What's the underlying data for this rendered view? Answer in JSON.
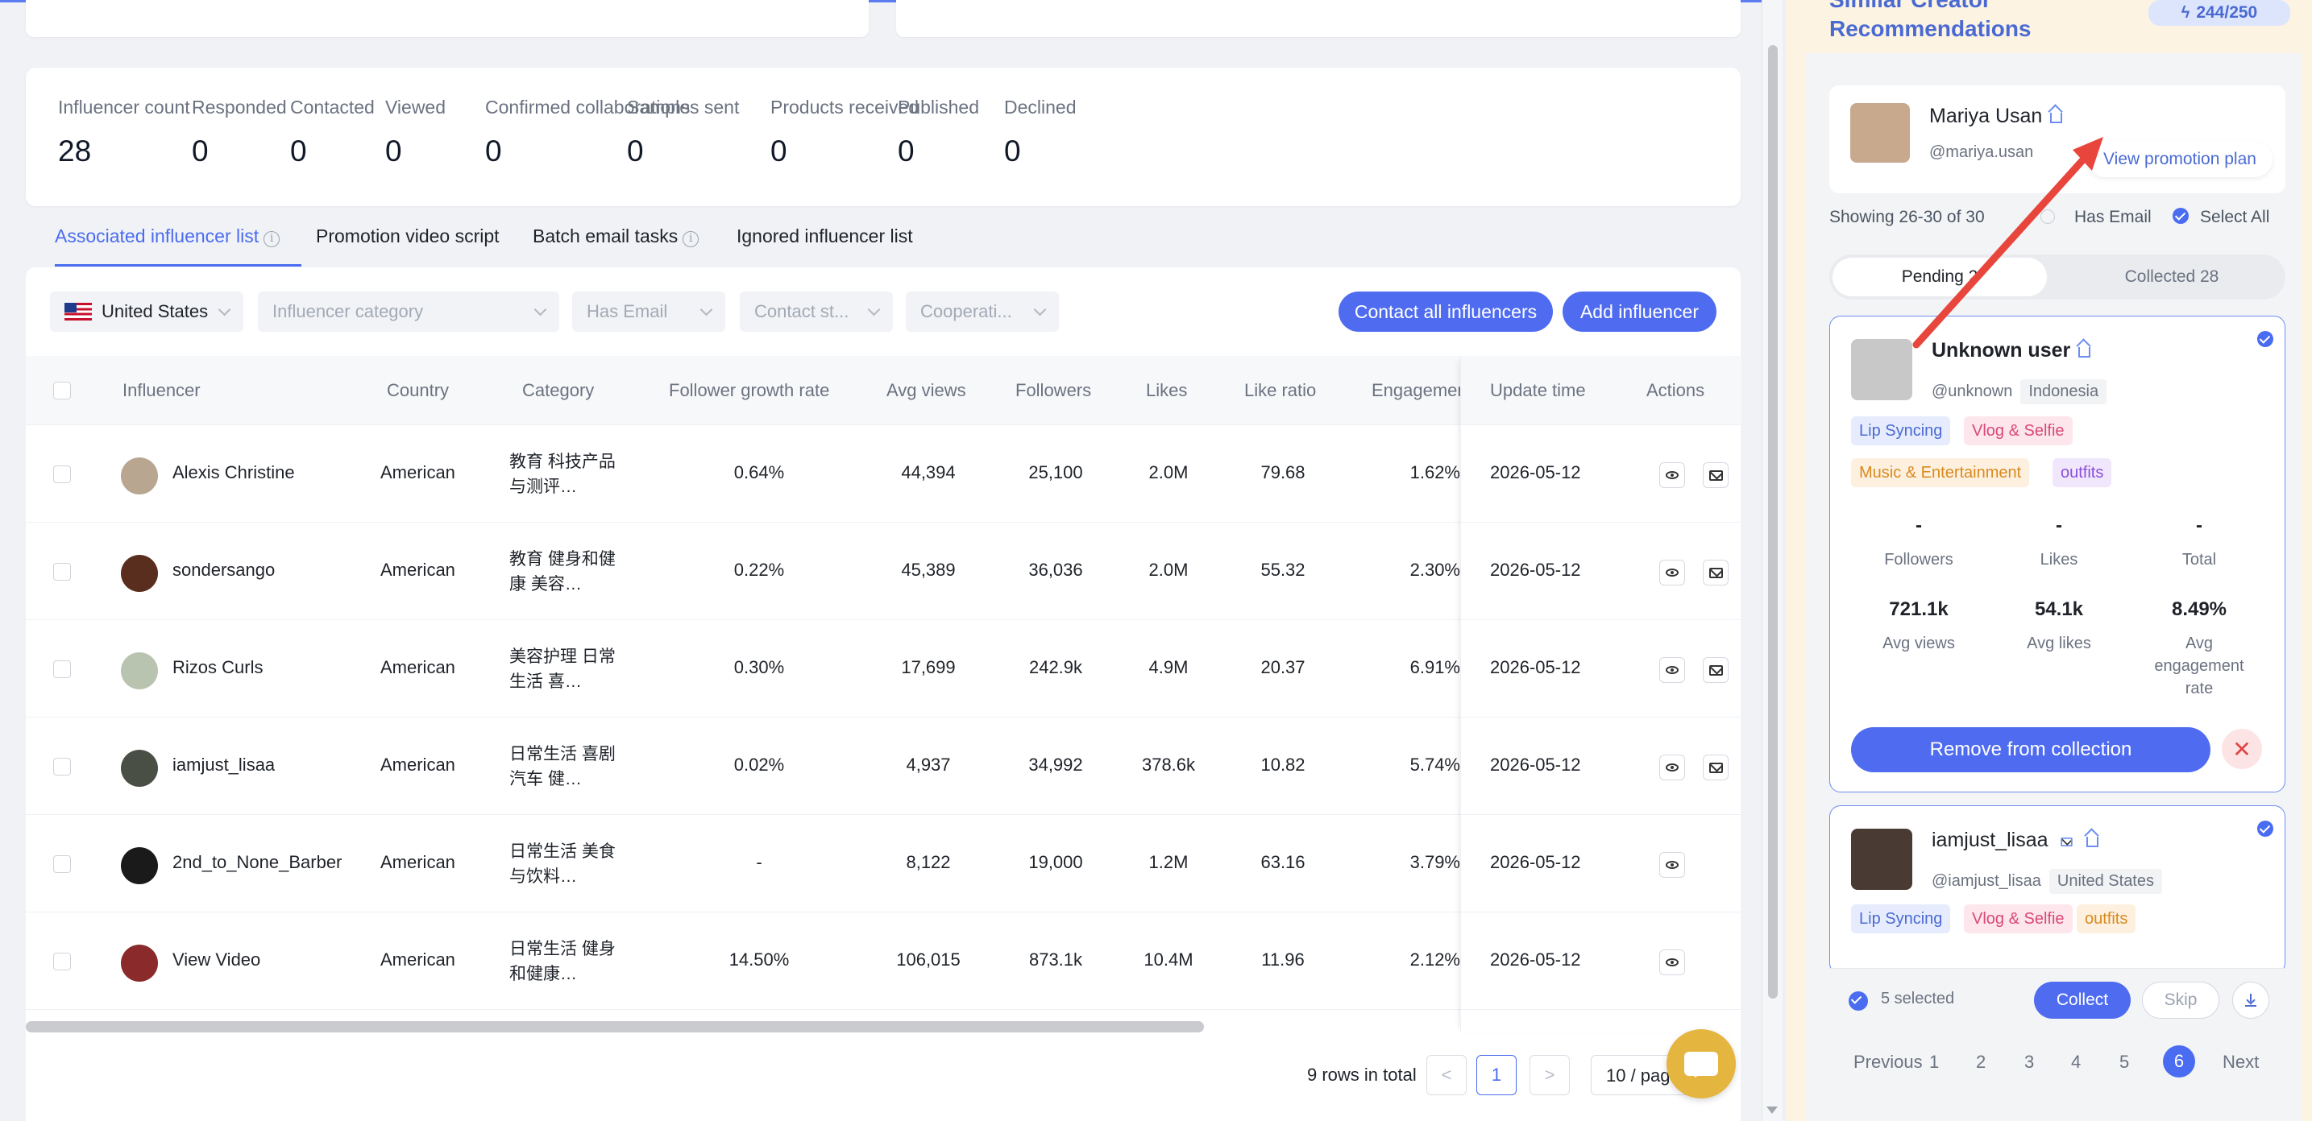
{
  "stats": [
    {
      "label": "Influencer count",
      "value": "28"
    },
    {
      "label": "Responded",
      "value": "0"
    },
    {
      "label": "Contacted",
      "value": "0"
    },
    {
      "label": "Viewed",
      "value": "0"
    },
    {
      "label": "Confirmed collaborations",
      "value": "0"
    },
    {
      "label": "Samples sent",
      "value": "0"
    },
    {
      "label": "Products received",
      "value": "0"
    },
    {
      "label": "Published",
      "value": "0"
    },
    {
      "label": "Declined",
      "value": "0"
    }
  ],
  "tabs": [
    "Associated influencer list",
    "Promotion video script",
    "Batch email tasks",
    "Ignored influencer list"
  ],
  "filters": {
    "country": "United States",
    "category": "Influencer category",
    "email": "Has Email",
    "contact": "Contact st...",
    "coop": "Cooperati..."
  },
  "buttons": {
    "contact_all": "Contact all influencers",
    "add": "Add influencer"
  },
  "columns": [
    "Influencer",
    "Country",
    "Category",
    "Follower growth rate",
    "Avg views",
    "Followers",
    "Likes",
    "Like ratio",
    "Engagemer",
    "Update time",
    "Actions"
  ],
  "rows": [
    {
      "name": "Alexis Christine",
      "country": "American",
      "category": "教育 科技产品与测评…",
      "growth": "0.64%",
      "avg_views": "44,394",
      "followers": "25,100",
      "likes": "2.0M",
      "like_ratio": "79.68",
      "engagement": "1.62%",
      "updated": "2026-05-12",
      "mail": true,
      "avatar_color": "#b8a690"
    },
    {
      "name": "sondersango",
      "country": "American",
      "category": "教育 健身和健康 美容…",
      "growth": "0.22%",
      "avg_views": "45,389",
      "followers": "36,036",
      "likes": "2.0M",
      "like_ratio": "55.32",
      "engagement": "2.30%",
      "updated": "2026-05-12",
      "mail": true,
      "avatar_color": "#5a2e1e"
    },
    {
      "name": "Rizos Curls",
      "country": "American",
      "category": "美容护理 日常生活 喜…",
      "growth": "0.30%",
      "avg_views": "17,699",
      "followers": "242.9k",
      "likes": "4.9M",
      "like_ratio": "20.37",
      "engagement": "6.91%",
      "updated": "2026-05-12",
      "mail": true,
      "avatar_color": "#b9c4b0"
    },
    {
      "name": "iamjust_lisaa",
      "country": "American",
      "category": "日常生活 喜剧 汽车 健…",
      "growth": "0.02%",
      "avg_views": "4,937",
      "followers": "34,992",
      "likes": "378.6k",
      "like_ratio": "10.82",
      "engagement": "5.74%",
      "updated": "2026-05-12",
      "mail": true,
      "avatar_color": "#4a4f45"
    },
    {
      "name": "2nd_to_None_Barber",
      "country": "American",
      "category": "日常生活 美食与饮料…",
      "growth": "-",
      "avg_views": "8,122",
      "followers": "19,000",
      "likes": "1.2M",
      "like_ratio": "63.16",
      "engagement": "3.79%",
      "updated": "2026-05-12",
      "mail": false,
      "avatar_color": "#1a1a1a"
    },
    {
      "name": "View Video",
      "country": "American",
      "category": "日常生活 健身和健康…",
      "growth": "14.50%",
      "avg_views": "106,015",
      "followers": "873.1k",
      "likes": "10.4M",
      "like_ratio": "11.96",
      "engagement": "2.12%",
      "updated": "2026-05-12",
      "mail": false,
      "avatar_color": "#8a2a2a"
    }
  ],
  "pagination": {
    "total": "9 rows in total",
    "current": "1",
    "prev": "<",
    "next": ">",
    "page_size": "10 / page"
  },
  "panel": {
    "title": "Similar Creator Recommendations",
    "quota": "244/250",
    "current_user": {
      "name": "Mariya Usan",
      "handle": "@mariya.usan",
      "view_plan": "View promotion plan"
    },
    "showing": "Showing 26-30 of 30",
    "has_email": "Has Email",
    "select_all": "Select All",
    "seg_pending": "Pending 2",
    "seg_collected": "Collected 28",
    "card1": {
      "name": "Unknown user",
      "handle": "@unknown",
      "location": "Indonesia",
      "tags": [
        "Lip Syncing",
        "Vlog & Selfie",
        "Music & Entertainment",
        "outfits"
      ],
      "metrics_top": [
        {
          "v": "-",
          "l": "Followers"
        },
        {
          "v": "-",
          "l": "Likes"
        },
        {
          "v": "-",
          "l": "Total"
        }
      ],
      "metrics_bottom": [
        {
          "v": "721.1k",
          "l": "Avg views"
        },
        {
          "v": "54.1k",
          "l": "Avg likes"
        },
        {
          "v": "8.49%",
          "l": "Avg engagement rate"
        }
      ],
      "remove": "Remove from collection",
      "close": "✕"
    },
    "card2": {
      "name": "iamjust_lisaa",
      "handle": "@iamjust_lisaa",
      "location": "United States",
      "tags": [
        "Lip Syncing",
        "Vlog & Selfie",
        "outfits"
      ]
    },
    "selected": "5 selected",
    "collect": "Collect",
    "skip": "Skip",
    "pages": [
      "Previous",
      "1",
      "2",
      "3",
      "4",
      "5",
      "6",
      "Next"
    ]
  },
  "colors": {
    "accent": "#4f6cf0",
    "panel_bg": "#fdf3e3",
    "annotation_arrow": "#e8463c"
  }
}
